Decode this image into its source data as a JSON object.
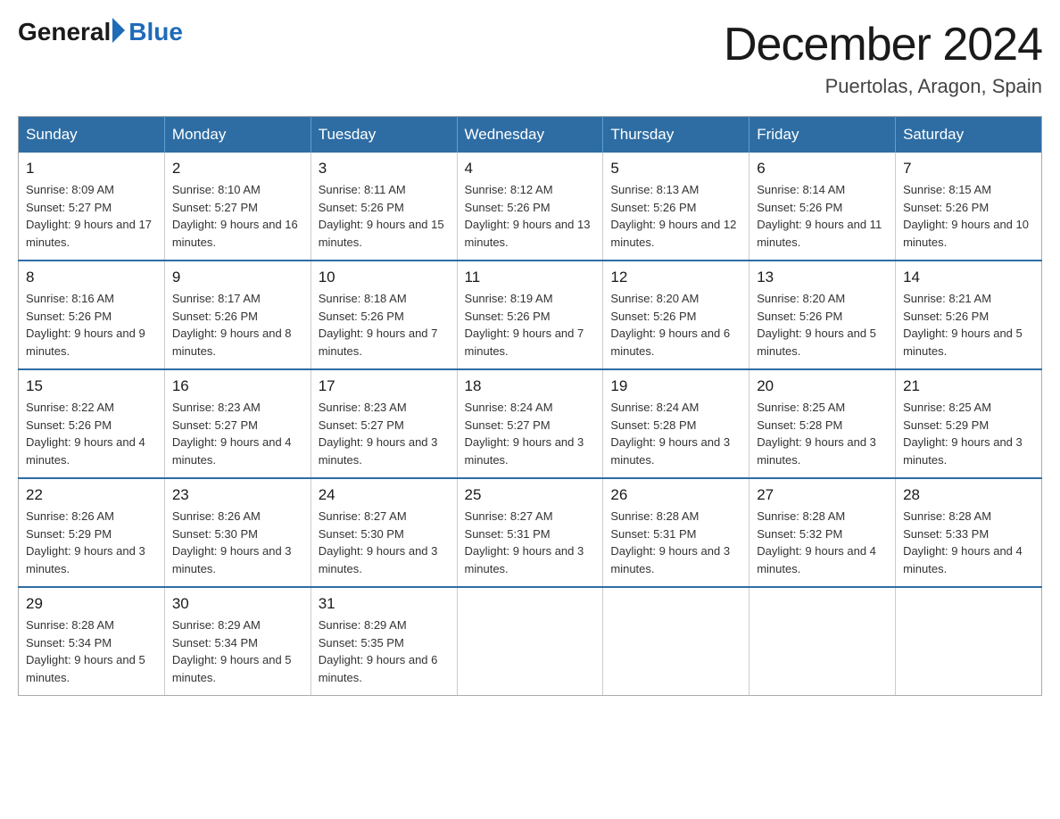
{
  "header": {
    "logo_general": "General",
    "logo_blue": "Blue",
    "month_title": "December 2024",
    "location": "Puertolas, Aragon, Spain"
  },
  "weekdays": [
    "Sunday",
    "Monday",
    "Tuesday",
    "Wednesday",
    "Thursday",
    "Friday",
    "Saturday"
  ],
  "weeks": [
    [
      {
        "day": "1",
        "sunrise": "8:09 AM",
        "sunset": "5:27 PM",
        "daylight": "9 hours and 17 minutes."
      },
      {
        "day": "2",
        "sunrise": "8:10 AM",
        "sunset": "5:27 PM",
        "daylight": "9 hours and 16 minutes."
      },
      {
        "day": "3",
        "sunrise": "8:11 AM",
        "sunset": "5:26 PM",
        "daylight": "9 hours and 15 minutes."
      },
      {
        "day": "4",
        "sunrise": "8:12 AM",
        "sunset": "5:26 PM",
        "daylight": "9 hours and 13 minutes."
      },
      {
        "day": "5",
        "sunrise": "8:13 AM",
        "sunset": "5:26 PM",
        "daylight": "9 hours and 12 minutes."
      },
      {
        "day": "6",
        "sunrise": "8:14 AM",
        "sunset": "5:26 PM",
        "daylight": "9 hours and 11 minutes."
      },
      {
        "day": "7",
        "sunrise": "8:15 AM",
        "sunset": "5:26 PM",
        "daylight": "9 hours and 10 minutes."
      }
    ],
    [
      {
        "day": "8",
        "sunrise": "8:16 AM",
        "sunset": "5:26 PM",
        "daylight": "9 hours and 9 minutes."
      },
      {
        "day": "9",
        "sunrise": "8:17 AM",
        "sunset": "5:26 PM",
        "daylight": "9 hours and 8 minutes."
      },
      {
        "day": "10",
        "sunrise": "8:18 AM",
        "sunset": "5:26 PM",
        "daylight": "9 hours and 7 minutes."
      },
      {
        "day": "11",
        "sunrise": "8:19 AM",
        "sunset": "5:26 PM",
        "daylight": "9 hours and 7 minutes."
      },
      {
        "day": "12",
        "sunrise": "8:20 AM",
        "sunset": "5:26 PM",
        "daylight": "9 hours and 6 minutes."
      },
      {
        "day": "13",
        "sunrise": "8:20 AM",
        "sunset": "5:26 PM",
        "daylight": "9 hours and 5 minutes."
      },
      {
        "day": "14",
        "sunrise": "8:21 AM",
        "sunset": "5:26 PM",
        "daylight": "9 hours and 5 minutes."
      }
    ],
    [
      {
        "day": "15",
        "sunrise": "8:22 AM",
        "sunset": "5:26 PM",
        "daylight": "9 hours and 4 minutes."
      },
      {
        "day": "16",
        "sunrise": "8:23 AM",
        "sunset": "5:27 PM",
        "daylight": "9 hours and 4 minutes."
      },
      {
        "day": "17",
        "sunrise": "8:23 AM",
        "sunset": "5:27 PM",
        "daylight": "9 hours and 3 minutes."
      },
      {
        "day": "18",
        "sunrise": "8:24 AM",
        "sunset": "5:27 PM",
        "daylight": "9 hours and 3 minutes."
      },
      {
        "day": "19",
        "sunrise": "8:24 AM",
        "sunset": "5:28 PM",
        "daylight": "9 hours and 3 minutes."
      },
      {
        "day": "20",
        "sunrise": "8:25 AM",
        "sunset": "5:28 PM",
        "daylight": "9 hours and 3 minutes."
      },
      {
        "day": "21",
        "sunrise": "8:25 AM",
        "sunset": "5:29 PM",
        "daylight": "9 hours and 3 minutes."
      }
    ],
    [
      {
        "day": "22",
        "sunrise": "8:26 AM",
        "sunset": "5:29 PM",
        "daylight": "9 hours and 3 minutes."
      },
      {
        "day": "23",
        "sunrise": "8:26 AM",
        "sunset": "5:30 PM",
        "daylight": "9 hours and 3 minutes."
      },
      {
        "day": "24",
        "sunrise": "8:27 AM",
        "sunset": "5:30 PM",
        "daylight": "9 hours and 3 minutes."
      },
      {
        "day": "25",
        "sunrise": "8:27 AM",
        "sunset": "5:31 PM",
        "daylight": "9 hours and 3 minutes."
      },
      {
        "day": "26",
        "sunrise": "8:28 AM",
        "sunset": "5:31 PM",
        "daylight": "9 hours and 3 minutes."
      },
      {
        "day": "27",
        "sunrise": "8:28 AM",
        "sunset": "5:32 PM",
        "daylight": "9 hours and 4 minutes."
      },
      {
        "day": "28",
        "sunrise": "8:28 AM",
        "sunset": "5:33 PM",
        "daylight": "9 hours and 4 minutes."
      }
    ],
    [
      {
        "day": "29",
        "sunrise": "8:28 AM",
        "sunset": "5:34 PM",
        "daylight": "9 hours and 5 minutes."
      },
      {
        "day": "30",
        "sunrise": "8:29 AM",
        "sunset": "5:34 PM",
        "daylight": "9 hours and 5 minutes."
      },
      {
        "day": "31",
        "sunrise": "8:29 AM",
        "sunset": "5:35 PM",
        "daylight": "9 hours and 6 minutes."
      },
      null,
      null,
      null,
      null
    ]
  ]
}
